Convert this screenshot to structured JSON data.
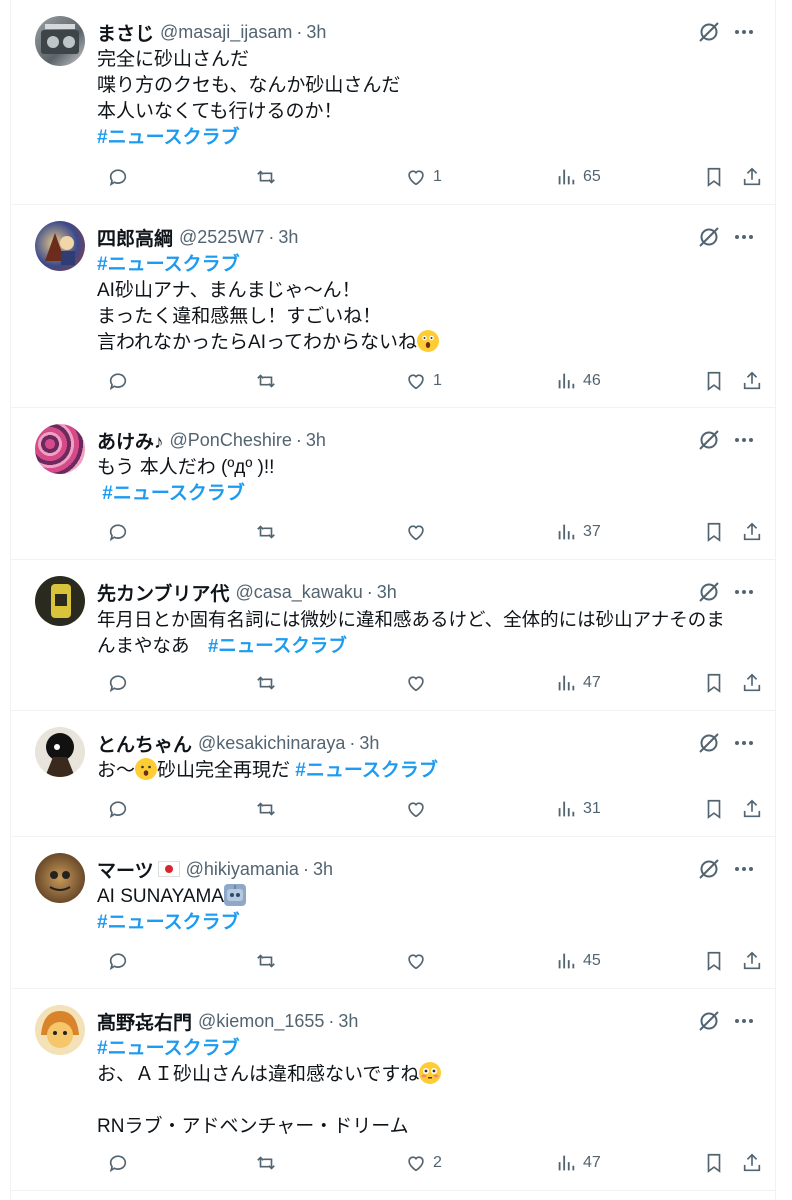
{
  "tweets": [
    {
      "name": "まさじ",
      "handle": "@masaji_ijasam",
      "time": "3h",
      "lines": [
        "完全に砂山さんだ",
        "喋り方のクセも、なんか砂山さんだ",
        "本人いなくても行けるのか！"
      ],
      "hashtag": "#ニュースクラブ",
      "likes": "1",
      "views": "65"
    },
    {
      "name": "四郎高綱",
      "handle": "@2525W7",
      "time": "3h",
      "hashtag": "#ニュースクラブ",
      "lines": [
        "AI砂山アナ、まんまじゃ〜ん！",
        "まったく違和感無し！すごいね！",
        "言われなかったらAIってわからないね"
      ],
      "likes": "1",
      "views": "46"
    },
    {
      "name": "あけみ♪",
      "handle": "@PonCheshire",
      "time": "3h",
      "lines": [
        "もう 本人だわ (ºдº )!!"
      ],
      "hashtag": " #ニュースクラブ",
      "likes": "",
      "views": "37"
    },
    {
      "name": "先カンブリア代",
      "handle": "@casa_kawaku",
      "time": "3h",
      "lines": [
        "年月日とか固有名詞には微妙に違和感あるけど、全体的には砂山アナそのま",
        "んまやなあ　"
      ],
      "hashtag": "#ニュースクラブ",
      "likes": "",
      "views": "47"
    },
    {
      "name": "とんちゃん",
      "handle": "@kesakichinaraya",
      "time": "3h",
      "prefix": "お〜",
      "text": "砂山完全再現だ ",
      "hashtag": "#ニュースクラブ",
      "likes": "",
      "views": "31"
    },
    {
      "name": "マーツ",
      "handle": "@hikiyamania",
      "time": "3h",
      "lines": [
        "AI SUNAYAMA"
      ],
      "hashtag": "#ニュースクラブ",
      "likes": "",
      "views": "45"
    },
    {
      "name": "髙野㐂右門",
      "handle": "@kiemon_1655",
      "time": "3h",
      "hashtag": "#ニュースクラブ",
      "lines": [
        "お、ＡＩ砂山さんは違和感ないですね",
        "",
        "RNラブ・アドベンチャー・ドリーム"
      ],
      "likes": "2",
      "views": "47"
    }
  ],
  "colors": {
    "text": "#0f1419",
    "muted": "#536471",
    "link": "#1d9bf0",
    "border": "#eff3f4"
  },
  "icons": [
    "reply-icon",
    "retweet-icon",
    "like-icon",
    "views-icon",
    "bookmark-icon",
    "share-icon",
    "grok-icon",
    "more-icon"
  ]
}
